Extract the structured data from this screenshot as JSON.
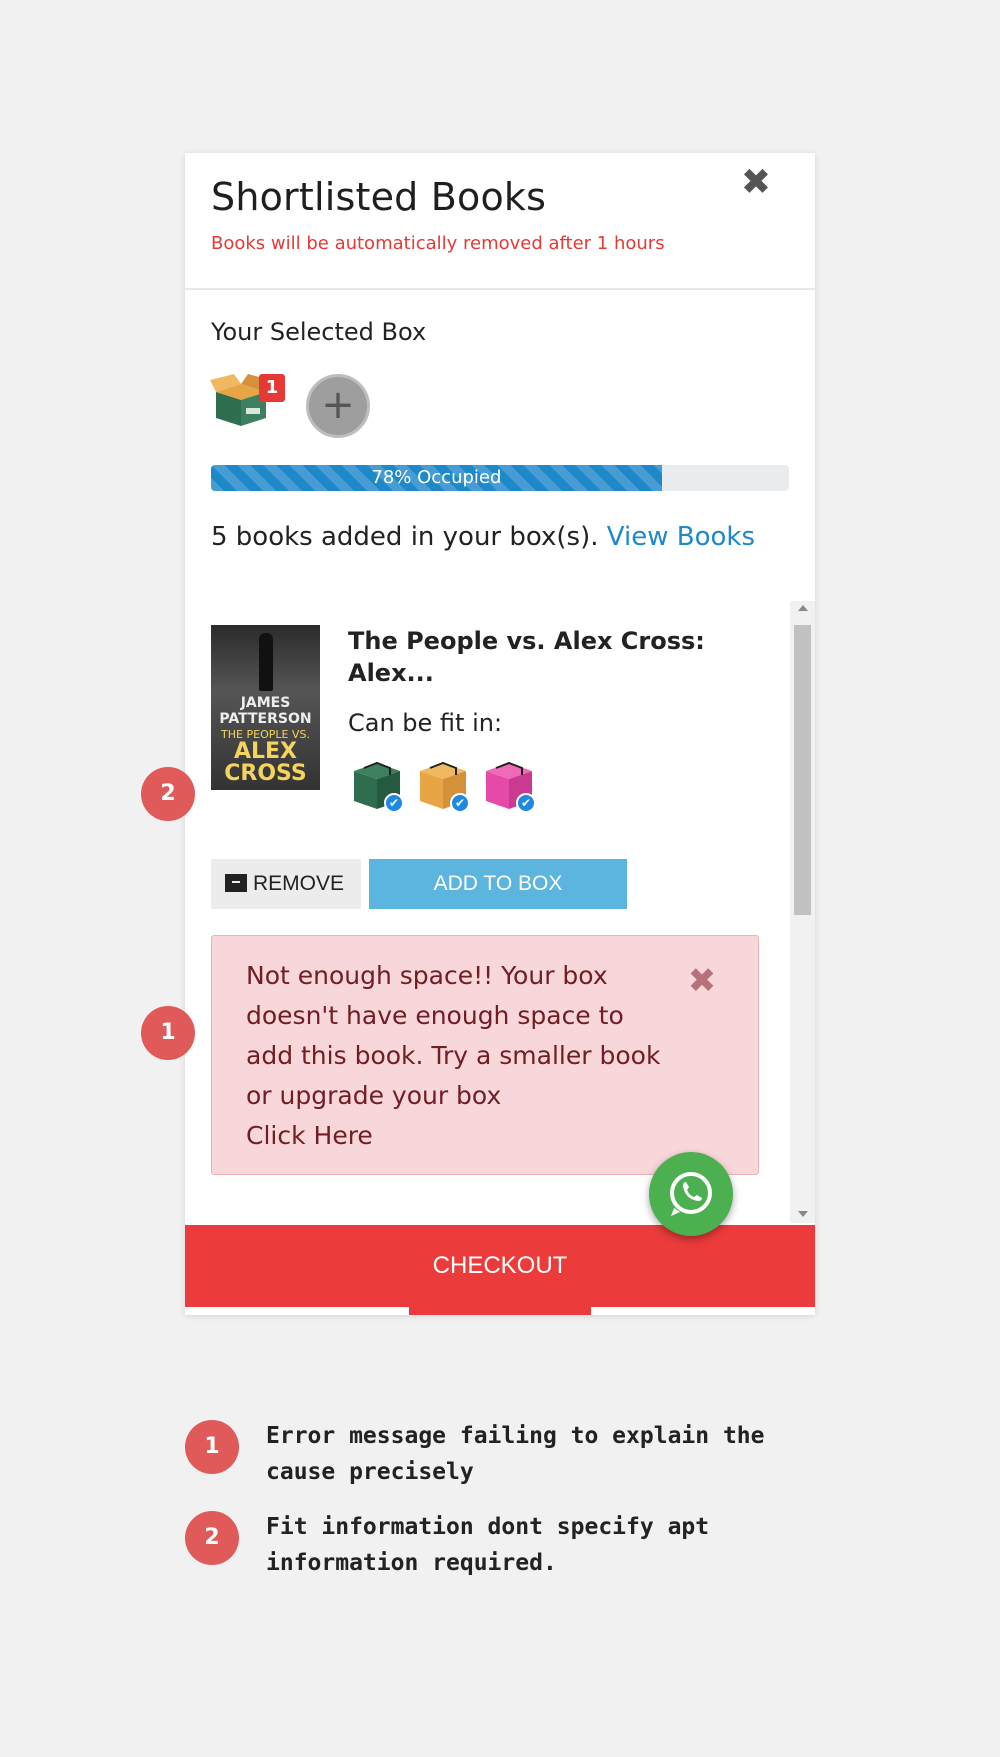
{
  "header": {
    "title": "Shortlisted Books",
    "subtitle": "Books will be automatically removed after 1 hours",
    "close_icon": "✖"
  },
  "box_section": {
    "title": "Your Selected Box",
    "box_count_badge": "1",
    "add_box_icon": "+",
    "progress": {
      "percent": 78,
      "label": "78% Occupied"
    },
    "books_added_text": "5 books added in your box(s).",
    "view_books_link": "View Books"
  },
  "book": {
    "cover": {
      "author": "JAMES\nPATTERSON",
      "title_small": "THE PEOPLE VS.",
      "title_big": "ALEX CROSS"
    },
    "title": "The People vs. Alex Cross: Alex...",
    "fit_label": "Can be fit in:",
    "fit_boxes": [
      {
        "name": "green-box",
        "color": "#2e6e4e"
      },
      {
        "name": "orange-box",
        "color": "#e8a545"
      },
      {
        "name": "pink-box",
        "color": "#e64aa8"
      }
    ],
    "remove_label": "REMOVE",
    "add_label": "ADD TO BOX"
  },
  "alert": {
    "message": "Not enough space!! Your box doesn't have enough space to add this book. Try a smaller book or upgrade your box",
    "link": "Click Here",
    "close_icon": "✖"
  },
  "checkout_label": "CHECKOUT",
  "markers": [
    {
      "number": "1",
      "note": "Error message failing to explain the cause precisely"
    },
    {
      "number": "2",
      "note": "Fit information dont specify apt information required."
    }
  ],
  "colors": {
    "accent_blue": "#1e88c9",
    "error_red": "#e53935",
    "checkout_red": "#eb3b3b",
    "marker": "#e05a5a",
    "whatsapp_green": "#4caf50"
  }
}
